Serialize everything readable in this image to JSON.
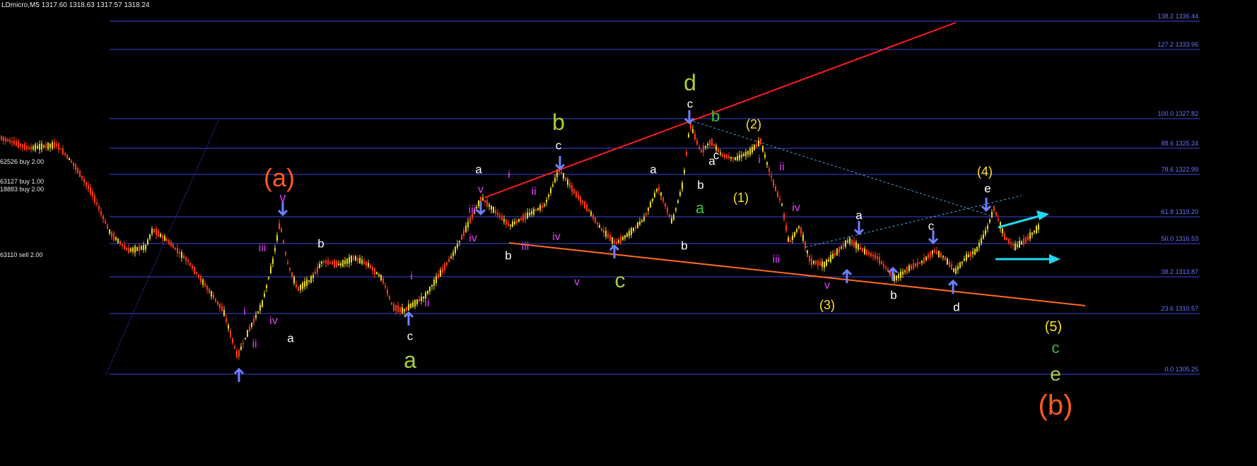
{
  "header": {
    "title": "LDmicro,M5  1317.60 1318.63 1317.57 1318.24"
  },
  "trade_labels": [
    "62526 buy 2.00",
    "63127 buy 1.00",
    "18883 buy 2.00",
    "63110 sell 2.00"
  ],
  "fibonacci_levels": [
    {
      "level": "138.2",
      "price": "1336.44"
    },
    {
      "level": "127.2",
      "price": "1333.96"
    },
    {
      "level": "100.0",
      "price": "1327.82"
    },
    {
      "level": "88.6",
      "price": "1325.24"
    },
    {
      "level": "78.6",
      "price": "1322.99"
    },
    {
      "level": "61.8",
      "price": "1319.20"
    },
    {
      "level": "50.0",
      "price": "1316.53"
    },
    {
      "level": "38.2",
      "price": "1313.87"
    },
    {
      "level": "23.6",
      "price": "1310.57"
    },
    {
      "level": "0.0",
      "price": "1305.25"
    }
  ],
  "wave_labels": [
    {
      "text": "(a)",
      "color": "#ff5a1e",
      "size": 36
    },
    {
      "text": "v",
      "color": "#e040ff",
      "size": 18
    },
    {
      "text": "iii",
      "color": "#e040ff",
      "size": 16
    },
    {
      "text": "iv",
      "color": "#e040ff",
      "size": 16
    },
    {
      "text": "i",
      "color": "#e040ff",
      "size": 16
    },
    {
      "text": "ii",
      "color": "#e040ff",
      "size": 16
    },
    {
      "text": "b",
      "color": "#ffffff",
      "size": 17
    },
    {
      "text": "a",
      "color": "#ffffff",
      "size": 17
    },
    {
      "text": "i",
      "color": "#e040ff",
      "size": 16
    },
    {
      "text": "ii",
      "color": "#e040ff",
      "size": 16
    },
    {
      "text": "c",
      "color": "#ffffff",
      "size": 17
    },
    {
      "text": "a",
      "color": "#a8cf3a",
      "size": 32
    },
    {
      "text": "iii",
      "color": "#e040ff",
      "size": 16
    },
    {
      "text": "iv",
      "color": "#e040ff",
      "size": 16
    },
    {
      "text": "a",
      "color": "#ffffff",
      "size": 17
    },
    {
      "text": "v",
      "color": "#e040ff",
      "size": 16
    },
    {
      "text": "b",
      "color": "#ffffff",
      "size": 17
    },
    {
      "text": "i",
      "color": "#e040ff",
      "size": 16
    },
    {
      "text": "ii",
      "color": "#e040ff",
      "size": 16
    },
    {
      "text": "iii",
      "color": "#e040ff",
      "size": 16
    },
    {
      "text": "iv",
      "color": "#e040ff",
      "size": 16
    },
    {
      "text": "b",
      "color": "#a8cf3a",
      "size": 32
    },
    {
      "text": "c",
      "color": "#ffffff",
      "size": 17
    },
    {
      "text": "v",
      "color": "#e040ff",
      "size": 16
    },
    {
      "text": "c",
      "color": "#a8cf3a",
      "size": 30
    },
    {
      "text": "a",
      "color": "#ffffff",
      "size": 17
    },
    {
      "text": "b",
      "color": "#ffffff",
      "size": 17
    },
    {
      "text": "d",
      "color": "#a8cf3a",
      "size": 32
    },
    {
      "text": "c",
      "color": "#ffffff",
      "size": 17
    },
    {
      "text": "b",
      "color": "#3fbf3f",
      "size": 22
    },
    {
      "text": "c",
      "color": "#ffffff",
      "size": 17
    },
    {
      "text": "a",
      "color": "#ffffff",
      "size": 17
    },
    {
      "text": "b",
      "color": "#ffffff",
      "size": 17
    },
    {
      "text": "a",
      "color": "#3fbf3f",
      "size": 22
    },
    {
      "text": "(2)",
      "color": "#ffe21e",
      "size": 18
    },
    {
      "text": "(1)",
      "color": "#ffe21e",
      "size": 18
    },
    {
      "text": "i",
      "color": "#e040ff",
      "size": 16
    },
    {
      "text": "ii",
      "color": "#e040ff",
      "size": 16
    },
    {
      "text": "iii",
      "color": "#e040ff",
      "size": 16
    },
    {
      "text": "iv",
      "color": "#e040ff",
      "size": 16
    },
    {
      "text": "v",
      "color": "#e040ff",
      "size": 16
    },
    {
      "text": "(3)",
      "color": "#ffe21e",
      "size": 18
    },
    {
      "text": "a",
      "color": "#ffffff",
      "size": 17
    },
    {
      "text": "b",
      "color": "#ffffff",
      "size": 17
    },
    {
      "text": "c",
      "color": "#ffffff",
      "size": 17
    },
    {
      "text": "d",
      "color": "#ffffff",
      "size": 17
    },
    {
      "text": "(4)",
      "color": "#ffe21e",
      "size": 18
    },
    {
      "text": "e",
      "color": "#ffffff",
      "size": 17
    },
    {
      "text": "(5)",
      "color": "#ffe21e",
      "size": 20
    },
    {
      "text": "c",
      "color": "#3fbf3f",
      "size": 22
    },
    {
      "text": "e",
      "color": "#a8cf3a",
      "size": 28
    },
    {
      "text": "(b)",
      "color": "#ff5a1e",
      "size": 40
    }
  ],
  "colors": {
    "background": "#000000",
    "fib_line": "#3c48d8",
    "bull_candle": "#e8d820",
    "bear_candle": "#ff3a10",
    "upper_channel": "#ff1e1e",
    "lower_channel": "#ff6a20",
    "dotted_line": "#4aa8e6",
    "arrow_cyan": "#20d8ee",
    "wave_arrow": "#7080ff"
  }
}
